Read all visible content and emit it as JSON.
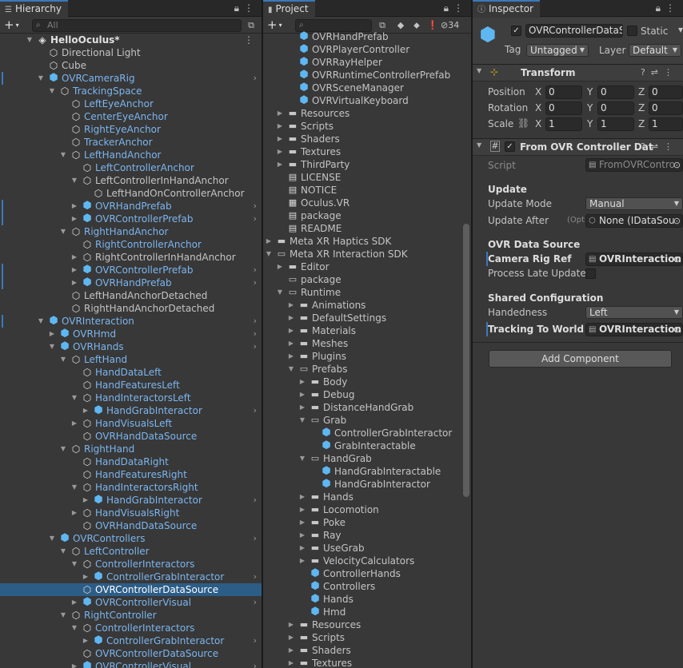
{
  "hierarchy": {
    "tab_label": "Hierarchy",
    "search_placeholder": "All",
    "rows": [
      {
        "label": "HelloOculus*",
        "depth": 0,
        "icon": "unity-icon",
        "arrow": "down",
        "style": "bold",
        "kebab": true
      },
      {
        "label": "Directional Light",
        "depth": 1,
        "icon": "gameobject-icon"
      },
      {
        "label": "Cube",
        "depth": 1,
        "icon": "gameobject-icon"
      },
      {
        "label": "OVRCameraRig",
        "depth": 1,
        "icon": "prefab-icon",
        "arrow": "down",
        "style": "blue",
        "chev": true,
        "mark": true
      },
      {
        "label": "TrackingSpace",
        "depth": 2,
        "icon": "gameobject-icon",
        "arrow": "down",
        "style": "blue"
      },
      {
        "label": "LeftEyeAnchor",
        "depth": 3,
        "icon": "gameobject-icon",
        "style": "blue"
      },
      {
        "label": "CenterEyeAnchor",
        "depth": 3,
        "icon": "gameobject-icon",
        "style": "blue"
      },
      {
        "label": "RightEyeAnchor",
        "depth": 3,
        "icon": "gameobject-icon",
        "style": "blue"
      },
      {
        "label": "TrackerAnchor",
        "depth": 3,
        "icon": "gameobject-icon",
        "style": "blue"
      },
      {
        "label": "LeftHandAnchor",
        "depth": 3,
        "icon": "gameobject-icon",
        "arrow": "down",
        "style": "blue"
      },
      {
        "label": "LeftControllerAnchor",
        "depth": 4,
        "icon": "gameobject-icon",
        "style": "blue"
      },
      {
        "label": "LeftControllerInHandAnchor",
        "depth": 4,
        "icon": "gameobject-plus-icon",
        "arrow": "down"
      },
      {
        "label": "LeftHandOnControllerAnchor",
        "depth": 5,
        "icon": "gameobject-icon"
      },
      {
        "label": "OVRHandPrefab",
        "depth": 4,
        "icon": "prefab-icon",
        "arrow": "right",
        "style": "blue",
        "chev": true,
        "mark": true
      },
      {
        "label": "OVRControllerPrefab",
        "depth": 4,
        "icon": "prefab-icon",
        "arrow": "right",
        "style": "blue",
        "chev": true,
        "mark": true
      },
      {
        "label": "RightHandAnchor",
        "depth": 3,
        "icon": "gameobject-icon",
        "arrow": "down",
        "style": "blue"
      },
      {
        "label": "RightControllerAnchor",
        "depth": 4,
        "icon": "gameobject-icon",
        "style": "blue"
      },
      {
        "label": "RightControllerInHandAnchor",
        "depth": 4,
        "icon": "gameobject-plus-icon",
        "arrow": "right"
      },
      {
        "label": "OVRControllerPrefab",
        "depth": 4,
        "icon": "prefab-icon",
        "arrow": "right",
        "style": "blue",
        "chev": true,
        "mark": true
      },
      {
        "label": "OVRHandPrefab",
        "depth": 4,
        "icon": "prefab-icon",
        "arrow": "right",
        "style": "blue",
        "chev": true,
        "mark": true
      },
      {
        "label": "LeftHandAnchorDetached",
        "depth": 3,
        "icon": "gameobject-plus-icon"
      },
      {
        "label": "RightHandAnchorDetached",
        "depth": 3,
        "icon": "gameobject-plus-icon"
      },
      {
        "label": "OVRInteraction",
        "depth": 1,
        "icon": "prefab-plus-icon",
        "arrow": "down",
        "style": "blue",
        "chev": true,
        "mark": true
      },
      {
        "label": "OVRHmd",
        "depth": 2,
        "icon": "prefab-plus-icon",
        "arrow": "right",
        "style": "blue",
        "chev": true
      },
      {
        "label": "OVRHands",
        "depth": 2,
        "icon": "prefab-plus-icon",
        "arrow": "down",
        "style": "blue",
        "chev": true
      },
      {
        "label": "LeftHand",
        "depth": 3,
        "icon": "gameobject-icon",
        "arrow": "down",
        "style": "blue"
      },
      {
        "label": "HandDataLeft",
        "depth": 4,
        "icon": "gameobject-icon",
        "style": "blue"
      },
      {
        "label": "HandFeaturesLeft",
        "depth": 4,
        "icon": "gameobject-icon",
        "style": "blue"
      },
      {
        "label": "HandInteractorsLeft",
        "depth": 4,
        "icon": "gameobject-icon",
        "arrow": "down",
        "style": "blue"
      },
      {
        "label": "HandGrabInteractor",
        "depth": 5,
        "icon": "prefab-plus-icon",
        "arrow": "right",
        "style": "blue",
        "chev": true
      },
      {
        "label": "HandVisualsLeft",
        "depth": 4,
        "icon": "gameobject-icon",
        "arrow": "right",
        "style": "blue"
      },
      {
        "label": "OVRHandDataSource",
        "depth": 4,
        "icon": "gameobject-icon",
        "style": "blue"
      },
      {
        "label": "RightHand",
        "depth": 3,
        "icon": "gameobject-icon",
        "arrow": "down",
        "style": "blue"
      },
      {
        "label": "HandDataRight",
        "depth": 4,
        "icon": "gameobject-icon",
        "style": "blue"
      },
      {
        "label": "HandFeaturesRight",
        "depth": 4,
        "icon": "gameobject-icon",
        "style": "blue"
      },
      {
        "label": "HandInteractorsRight",
        "depth": 4,
        "icon": "gameobject-icon",
        "arrow": "down",
        "style": "blue"
      },
      {
        "label": "HandGrabInteractor",
        "depth": 5,
        "icon": "prefab-plus-icon",
        "arrow": "right",
        "style": "blue",
        "chev": true
      },
      {
        "label": "HandVisualsRight",
        "depth": 4,
        "icon": "gameobject-icon",
        "arrow": "right",
        "style": "blue"
      },
      {
        "label": "OVRHandDataSource",
        "depth": 4,
        "icon": "gameobject-icon",
        "style": "blue"
      },
      {
        "label": "OVRControllers",
        "depth": 2,
        "icon": "prefab-plus-icon",
        "arrow": "down",
        "style": "blue",
        "chev": true
      },
      {
        "label": "LeftController",
        "depth": 3,
        "icon": "gameobject-icon",
        "arrow": "down",
        "style": "blue"
      },
      {
        "label": "ControllerInteractors",
        "depth": 4,
        "icon": "gameobject-icon",
        "arrow": "down",
        "style": "blue"
      },
      {
        "label": "ControllerGrabInteractor",
        "depth": 5,
        "icon": "prefab-plus-icon",
        "arrow": "right",
        "style": "blue",
        "chev": true
      },
      {
        "label": "OVRControllerDataSource",
        "depth": 4,
        "icon": "gameobject-icon",
        "selected": true
      },
      {
        "label": "OVRControllerVisual",
        "depth": 4,
        "icon": "prefab-icon",
        "arrow": "right",
        "style": "blue",
        "chev": true
      },
      {
        "label": "RightController",
        "depth": 3,
        "icon": "gameobject-icon",
        "arrow": "down",
        "style": "blue"
      },
      {
        "label": "ControllerInteractors",
        "depth": 4,
        "icon": "gameobject-icon",
        "arrow": "down",
        "style": "blue"
      },
      {
        "label": "ControllerGrabInteractor",
        "depth": 5,
        "icon": "prefab-plus-icon",
        "arrow": "right",
        "style": "blue",
        "chev": true
      },
      {
        "label": "OVRControllerDataSource",
        "depth": 4,
        "icon": "gameobject-icon",
        "style": "blue"
      },
      {
        "label": "OVRControllerVisual",
        "depth": 4,
        "icon": "prefab-icon",
        "arrow": "right",
        "style": "blue",
        "chev": true
      }
    ]
  },
  "project": {
    "tab_label": "Project",
    "hidden_count": "34",
    "rows": [
      {
        "label": "OVRHandPrefab",
        "depth": 3,
        "icon": "prefab-icon"
      },
      {
        "label": "OVRPlayerController",
        "depth": 3,
        "icon": "prefab-icon"
      },
      {
        "label": "OVRRayHelper",
        "depth": 3,
        "icon": "prefab-icon"
      },
      {
        "label": "OVRRuntimeControllerPrefab",
        "depth": 3,
        "icon": "prefab-icon"
      },
      {
        "label": "OVRSceneManager",
        "depth": 3,
        "icon": "prefab-icon"
      },
      {
        "label": "OVRVirtualKeyboard",
        "depth": 3,
        "icon": "prefab-icon"
      },
      {
        "label": "Resources",
        "depth": 2,
        "icon": "folder-icon",
        "arrow": "right"
      },
      {
        "label": "Scripts",
        "depth": 2,
        "icon": "folder-icon",
        "arrow": "right"
      },
      {
        "label": "Shaders",
        "depth": 2,
        "icon": "folder-icon",
        "arrow": "right"
      },
      {
        "label": "Textures",
        "depth": 2,
        "icon": "folder-icon",
        "arrow": "right"
      },
      {
        "label": "ThirdParty",
        "depth": 2,
        "icon": "folder-icon",
        "arrow": "right"
      },
      {
        "label": "LICENSE",
        "depth": 2,
        "icon": "text-file-icon"
      },
      {
        "label": "NOTICE",
        "depth": 2,
        "icon": "text-file-icon"
      },
      {
        "label": "Oculus.VR",
        "depth": 2,
        "icon": "asmdef-icon"
      },
      {
        "label": "package",
        "depth": 2,
        "icon": "text-file-icon"
      },
      {
        "label": "README",
        "depth": 2,
        "icon": "text-file-icon"
      },
      {
        "label": "Meta XR Haptics SDK",
        "depth": 1,
        "icon": "folder-icon",
        "arrow": "right"
      },
      {
        "label": "Meta XR Interaction SDK",
        "depth": 1,
        "icon": "folder-open-icon",
        "arrow": "down"
      },
      {
        "label": "Editor",
        "depth": 2,
        "icon": "folder-icon",
        "arrow": "right"
      },
      {
        "label": "package",
        "depth": 2,
        "icon": "folder-empty-icon"
      },
      {
        "label": "Runtime",
        "depth": 2,
        "icon": "folder-open-icon",
        "arrow": "down"
      },
      {
        "label": "Animations",
        "depth": 3,
        "icon": "folder-icon",
        "arrow": "right"
      },
      {
        "label": "DefaultSettings",
        "depth": 3,
        "icon": "folder-icon",
        "arrow": "right"
      },
      {
        "label": "Materials",
        "depth": 3,
        "icon": "folder-icon",
        "arrow": "right"
      },
      {
        "label": "Meshes",
        "depth": 3,
        "icon": "folder-icon",
        "arrow": "right"
      },
      {
        "label": "Plugins",
        "depth": 3,
        "icon": "folder-icon",
        "arrow": "right"
      },
      {
        "label": "Prefabs",
        "depth": 3,
        "icon": "folder-open-icon",
        "arrow": "down"
      },
      {
        "label": "Body",
        "depth": 4,
        "icon": "folder-icon",
        "arrow": "right"
      },
      {
        "label": "Debug",
        "depth": 4,
        "icon": "folder-icon",
        "arrow": "right"
      },
      {
        "label": "DistanceHandGrab",
        "depth": 4,
        "icon": "folder-icon",
        "arrow": "right"
      },
      {
        "label": "Grab",
        "depth": 4,
        "icon": "folder-open-icon",
        "arrow": "down"
      },
      {
        "label": "ControllerGrabInteractor",
        "depth": 5,
        "icon": "prefab-icon"
      },
      {
        "label": "GrabInteractable",
        "depth": 5,
        "icon": "prefab-icon"
      },
      {
        "label": "HandGrab",
        "depth": 4,
        "icon": "folder-open-icon",
        "arrow": "down"
      },
      {
        "label": "HandGrabInteractable",
        "depth": 5,
        "icon": "prefab-icon"
      },
      {
        "label": "HandGrabInteractor",
        "depth": 5,
        "icon": "prefab-icon"
      },
      {
        "label": "Hands",
        "depth": 4,
        "icon": "folder-icon",
        "arrow": "right"
      },
      {
        "label": "Locomotion",
        "depth": 4,
        "icon": "folder-icon",
        "arrow": "right"
      },
      {
        "label": "Poke",
        "depth": 4,
        "icon": "folder-icon",
        "arrow": "right"
      },
      {
        "label": "Ray",
        "depth": 4,
        "icon": "folder-icon",
        "arrow": "right"
      },
      {
        "label": "UseGrab",
        "depth": 4,
        "icon": "folder-icon",
        "arrow": "right"
      },
      {
        "label": "VelocityCalculators",
        "depth": 4,
        "icon": "folder-icon",
        "arrow": "right"
      },
      {
        "label": "ControllerHands",
        "depth": 4,
        "icon": "prefab-icon"
      },
      {
        "label": "Controllers",
        "depth": 4,
        "icon": "prefab-icon"
      },
      {
        "label": "Hands",
        "depth": 4,
        "icon": "prefab-icon"
      },
      {
        "label": "Hmd",
        "depth": 4,
        "icon": "prefab-icon"
      },
      {
        "label": "Resources",
        "depth": 3,
        "icon": "folder-icon",
        "arrow": "right"
      },
      {
        "label": "Scripts",
        "depth": 3,
        "icon": "folder-icon",
        "arrow": "right"
      },
      {
        "label": "Shaders",
        "depth": 3,
        "icon": "folder-icon",
        "arrow": "right"
      },
      {
        "label": "Textures",
        "depth": 3,
        "icon": "folder-icon",
        "arrow": "right"
      }
    ]
  },
  "inspector": {
    "tab_label": "Inspector",
    "object_name": "OVRControllerDataS",
    "static_label": "Static",
    "tag_label": "Tag",
    "tag_value": "Untagged",
    "layer_label": "Layer",
    "layer_value": "Default",
    "transform": {
      "title": "Transform",
      "position_label": "Position",
      "rotation_label": "Rotation",
      "scale_label": "Scale",
      "x_label": "X",
      "y_label": "Y",
      "z_label": "Z",
      "position": {
        "x": "0",
        "y": "0",
        "z": "0"
      },
      "rotation": {
        "x": "0",
        "y": "0",
        "z": "0"
      },
      "scale": {
        "x": "1",
        "y": "1",
        "z": "1"
      }
    },
    "component": {
      "title": "From OVR Controller Dat",
      "script_label": "Script",
      "script_value": "FromOVRContro",
      "update_header": "Update",
      "update_mode_label": "Update Mode",
      "update_mode_value": "Manual",
      "update_after_label": "Update After",
      "update_after_hint": "(Opt",
      "update_after_value": "None (IDataSou",
      "ovr_header": "OVR Data Source",
      "camera_rig_label": "Camera Rig Ref",
      "camera_rig_value": "OVRInteraction",
      "process_late_label": "Process Late Update",
      "shared_header": "Shared Configuration",
      "handedness_label": "Handedness",
      "handedness_value": "Left",
      "tracking_label": "Tracking To World T",
      "tracking_value": "OVRInteraction"
    },
    "add_component_label": "Add Component"
  },
  "colors": {
    "panel_bg": "#383838",
    "selection": "#2c5d87",
    "prefab_text": "#7cb5ee",
    "accent": "#3a79bb"
  }
}
